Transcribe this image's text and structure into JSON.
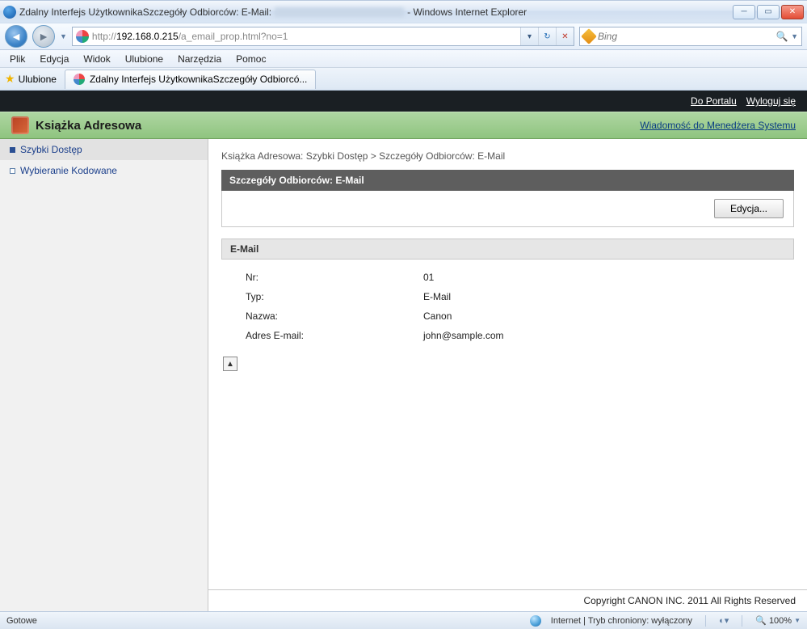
{
  "window": {
    "title_prefix": "Zdalny Interfejs UżytkownikaSzczegóły Odbiorców: E-Mail:",
    "title_suffix": " - Windows Internet Explorer"
  },
  "nav": {
    "url_prefix": "http://",
    "url_host": "192.168.0.215",
    "url_path": "/a_email_prop.html?no=1",
    "search_placeholder": "Bing"
  },
  "menus": [
    "Plik",
    "Edycja",
    "Widok",
    "Ulubione",
    "Narzędzia",
    "Pomoc"
  ],
  "favbar": {
    "favorites_label": "Ulubione",
    "tab_title": "Zdalny Interfejs UżytkownikaSzczegóły Odbiorcó..."
  },
  "topbar": {
    "portal": "Do Portalu",
    "logout": "Wyloguj się"
  },
  "greenbar": {
    "title": "Książka Adresowa",
    "right_link": "Wiadomość do Menedżera Systemu"
  },
  "sidebar": {
    "items": [
      {
        "label": "Szybki Dostęp",
        "active": true
      },
      {
        "label": "Wybieranie Kodowane",
        "active": false
      }
    ]
  },
  "main": {
    "breadcrumb": "Książka Adresowa: Szybki Dostęp > Szczegóły Odbiorców: E-Mail",
    "panel_title": "Szczegóły Odbiorców: E-Mail",
    "edit_button": "Edycja...",
    "section_title": "E-Mail",
    "rows": [
      {
        "k": "Nr:",
        "v": "01"
      },
      {
        "k": "Typ:",
        "v": "E-Mail"
      },
      {
        "k": "Nazwa:",
        "v": "Canon"
      },
      {
        "k": "Adres E-mail:",
        "v": "john@sample.com"
      }
    ],
    "copyright": "Copyright CANON INC. 2011 All Rights Reserved"
  },
  "status": {
    "left": "Gotowe",
    "zone": "Internet | Tryb chroniony: wyłączony",
    "zoom": "100%"
  }
}
